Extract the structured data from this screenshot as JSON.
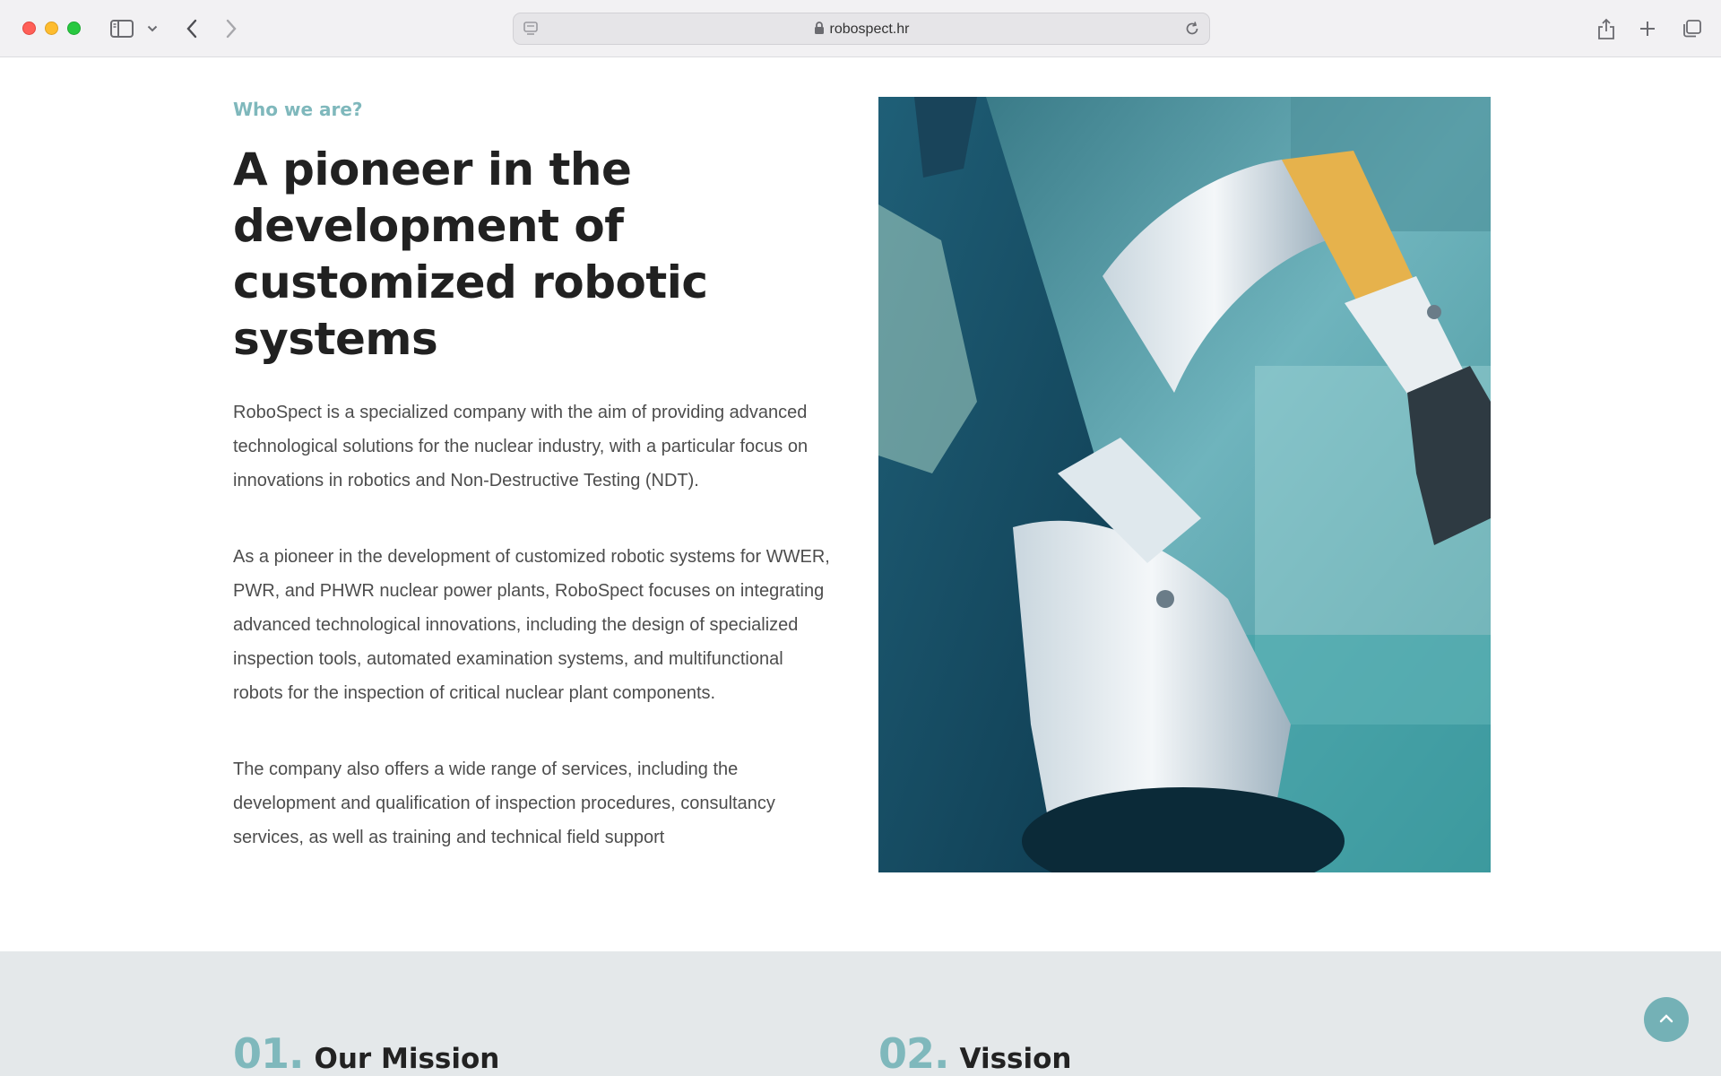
{
  "browser": {
    "url": "robospect.hr",
    "icons": [
      "sidebar-icon",
      "chevron-down-icon",
      "back-icon",
      "forward-icon",
      "share-icon",
      "plus-icon",
      "tabs-icon",
      "lock-icon",
      "reload-icon"
    ]
  },
  "about": {
    "eyebrow": "Who we are?",
    "headline": "A pioneer in the development of customized robotic systems",
    "paragraphs": [
      "RoboSpect is a specialized company with the aim of providing advanced technological solutions for the nuclear industry, with a particular focus on innovations in robotics and Non-Destructive Testing (NDT).",
      "As a pioneer in the development of customized robotic systems for WWER, PWR, and PHWR nuclear power plants, RoboSpect focuses on integrating advanced technological innovations, including the design of specialized inspection tools, automated examination systems, and multifunctional robots for the inspection of critical nuclear plant components.",
      "The company also offers a wide range of services, including the development and qualification of inspection procedures, consultancy services, as well as training and technical field support"
    ]
  },
  "features": [
    {
      "number": "01.",
      "title": "Our Mission"
    },
    {
      "number": "02.",
      "title": "Vission"
    }
  ],
  "colors": {
    "accent": "#7fb8bc",
    "heading": "#212121",
    "body": "#4d4d4d",
    "section_bg": "#e4e8ea"
  }
}
